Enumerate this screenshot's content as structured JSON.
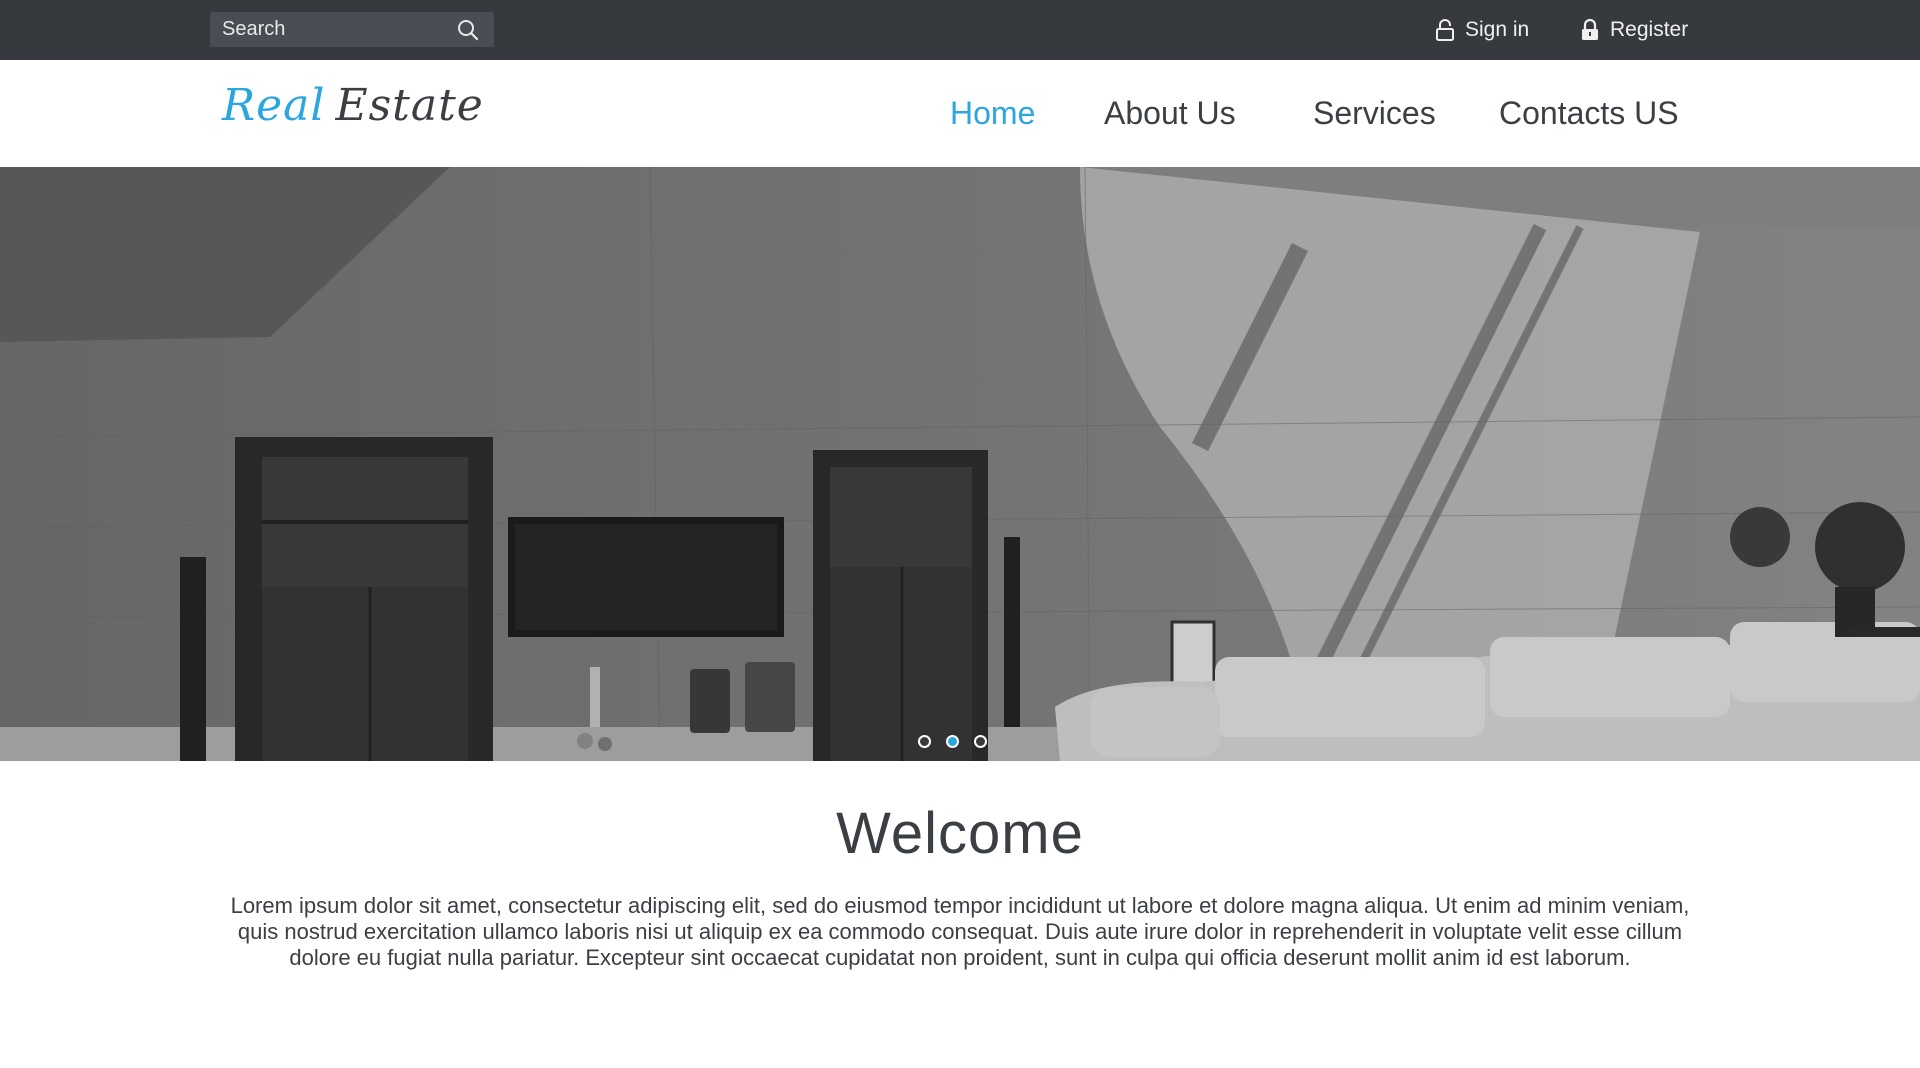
{
  "topbar": {
    "search_placeholder": "Search",
    "sign_in_label": "Sign in",
    "register_label": "Register"
  },
  "header": {
    "logo_part1": "Real",
    "logo_part2": "Estate",
    "nav": [
      {
        "label": "Home",
        "active": true
      },
      {
        "label": "About Us",
        "active": false
      },
      {
        "label": "Services",
        "active": false
      },
      {
        "label": "Contacts US",
        "active": false
      }
    ]
  },
  "hero": {
    "slides": 3,
    "active_slide": 2
  },
  "welcome": {
    "title": "Welcome",
    "body": "Lorem ipsum dolor sit amet, consectetur adipiscing elit, sed do eiusmod tempor incididunt ut labore et dolore magna aliqua. Ut enim ad minim veniam, quis nostrud exercitation ullamco laboris nisi ut aliquip ex ea commodo consequat. Duis aute irure dolor in reprehenderit in voluptate velit esse cillum dolore eu fugiat nulla pariatur. Excepteur sint occaecat cupidatat non proident, sunt in culpa qui officia deserunt mollit anim id est laborum."
  },
  "colors": {
    "accent": "#2ba6de",
    "topbar": "#363a3f",
    "text": "#3b3f44"
  }
}
